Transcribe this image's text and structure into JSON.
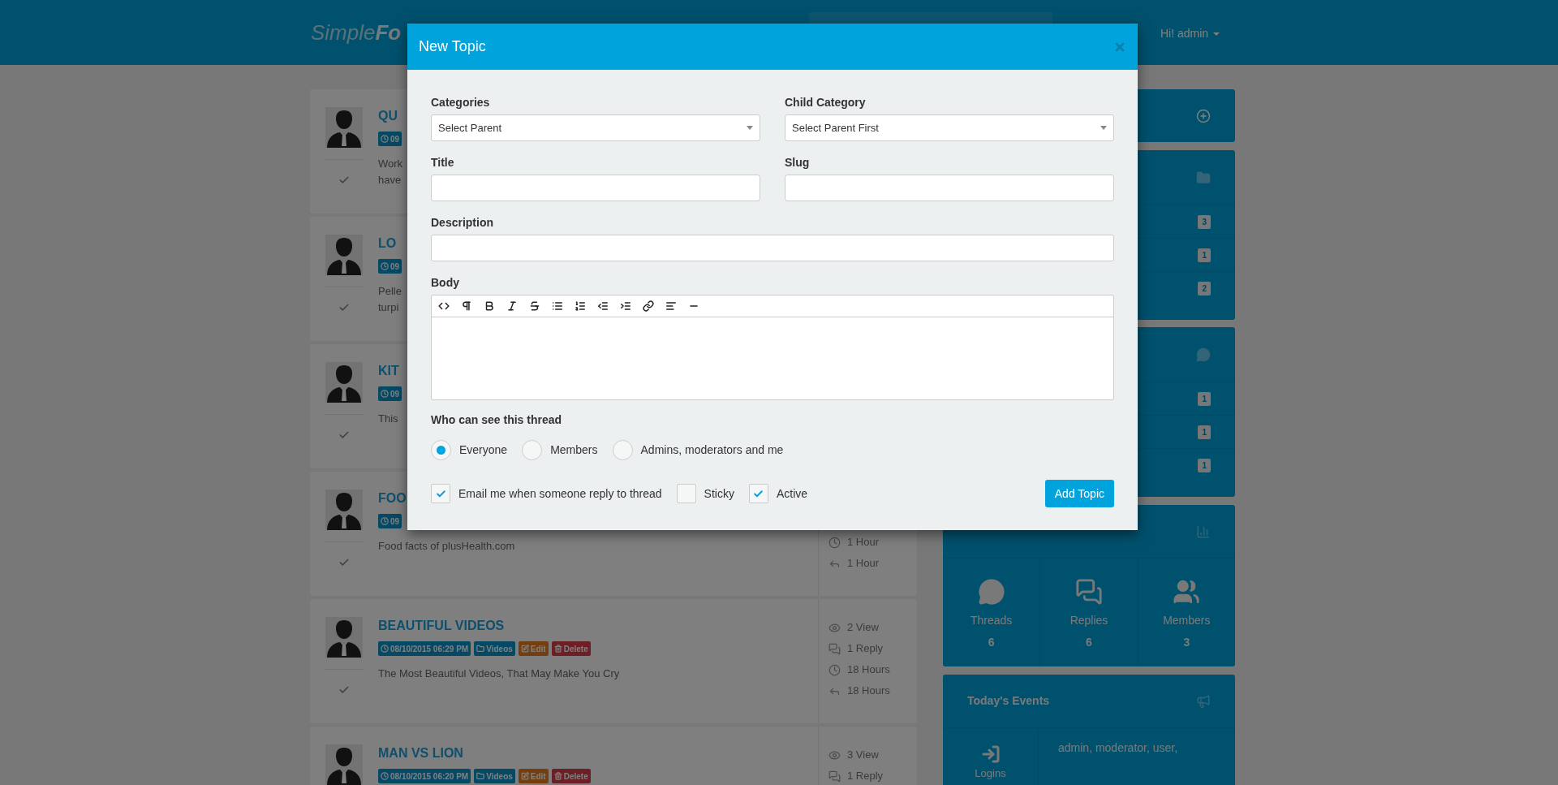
{
  "header": {
    "logo_light": "Simple",
    "logo_bold": "Fo",
    "user_menu": "Hi! admin"
  },
  "topics": [
    {
      "title": "QU",
      "tags": [
        {
          "kind": "date",
          "text": "09"
        }
      ],
      "lines": [
        "Work",
        "have"
      ]
    },
    {
      "title": "LO",
      "tags": [
        {
          "kind": "date",
          "text": "09"
        }
      ],
      "lines": [
        "Pelle",
        "turpi"
      ]
    },
    {
      "title": "KIT",
      "tags": [
        {
          "kind": "date",
          "text": "09"
        }
      ],
      "lines": [
        "This"
      ]
    },
    {
      "title": "FOO",
      "tags": [
        {
          "kind": "date",
          "text": "09"
        }
      ],
      "lines": [
        "Food facts of plusHealth.com"
      ],
      "stats": [
        {
          "kind": "time",
          "text": "1 Hour"
        },
        {
          "kind": "last",
          "text": "1 Hour"
        }
      ]
    },
    {
      "title": "BEAUTIFUL VIDEOS",
      "tags": [
        {
          "kind": "date",
          "text": "08/10/2015 06:29 PM"
        },
        {
          "kind": "category",
          "text": "Videos"
        },
        {
          "kind": "edit",
          "text": "Edit"
        },
        {
          "kind": "delete",
          "text": "Delete"
        }
      ],
      "lines": [
        "The Most Beautiful Videos, That May Make You Cry"
      ],
      "stats": [
        {
          "kind": "view",
          "text": "2 View"
        },
        {
          "kind": "reply",
          "text": "1 Reply"
        },
        {
          "kind": "time",
          "text": "18 Hours"
        },
        {
          "kind": "last",
          "text": "18 Hours"
        }
      ]
    },
    {
      "title": "MAN VS LION",
      "tags": [
        {
          "kind": "date",
          "text": "08/10/2015 06:20 PM"
        },
        {
          "kind": "category",
          "text": "Videos"
        },
        {
          "kind": "edit",
          "text": "Edit"
        },
        {
          "kind": "delete",
          "text": "Delete"
        }
      ],
      "stats": [
        {
          "kind": "view",
          "text": "3 View"
        },
        {
          "kind": "reply",
          "text": "1 Reply"
        }
      ]
    }
  ],
  "sidebar": {
    "categories": {
      "counts": [
        "3",
        "1",
        "2"
      ]
    },
    "recent": {
      "counts": [
        "1",
        "1",
        "1"
      ]
    },
    "statistics": [
      {
        "kind": "threads",
        "label": "Threads",
        "value": "6"
      },
      {
        "kind": "replies",
        "label": "Replies",
        "value": "6"
      },
      {
        "kind": "members",
        "label": "Members",
        "value": "3"
      }
    ],
    "events": {
      "title": "Today's Events",
      "label": "Logins",
      "users": "admin, moderator, user,"
    }
  },
  "modal": {
    "title": "New Topic",
    "categories": {
      "label": "Categories",
      "value": "Select Parent"
    },
    "child_category": {
      "label": "Child Category",
      "value": "Select Parent First"
    },
    "title_field": {
      "label": "Title"
    },
    "slug": {
      "label": "Slug"
    },
    "description": {
      "label": "Description"
    },
    "body": {
      "label": "Body"
    },
    "visibility": {
      "label": "Who can see this thread",
      "options": [
        {
          "label": "Everyone",
          "selected": true
        },
        {
          "label": "Members",
          "selected": false
        },
        {
          "label": "Admins, moderators and me",
          "selected": false
        }
      ]
    },
    "options": [
      {
        "label": "Email me when someone reply to thread",
        "checked": true
      },
      {
        "label": "Sticky",
        "checked": false
      },
      {
        "label": "Active",
        "checked": true
      }
    ],
    "submit": "Add Topic"
  }
}
